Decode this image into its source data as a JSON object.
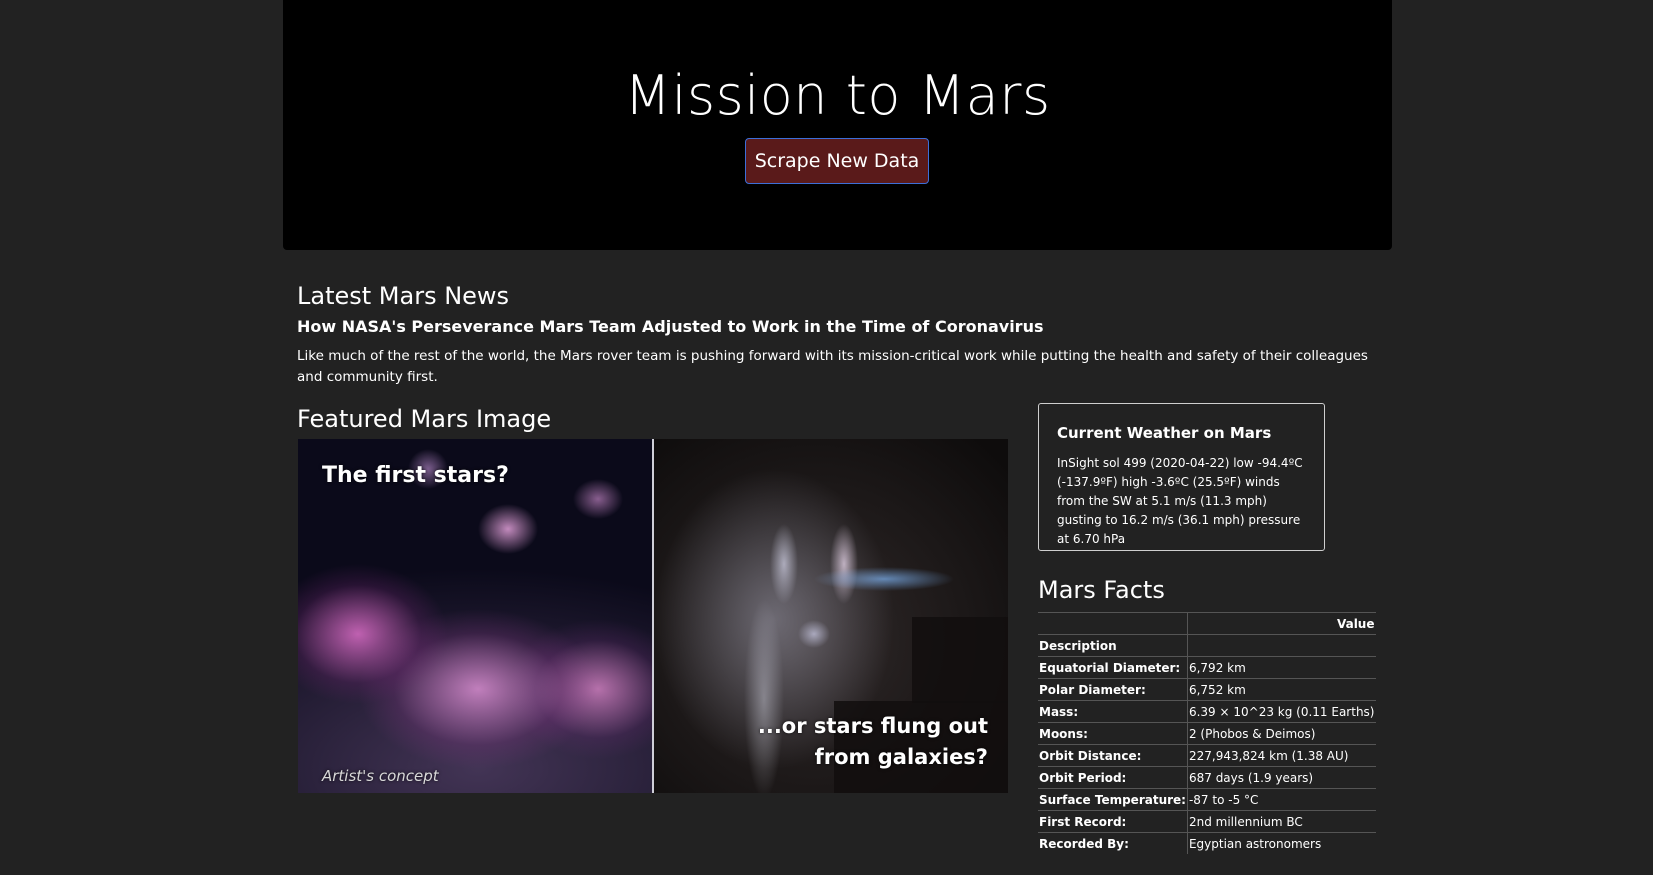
{
  "header": {
    "title": "Mission to Mars",
    "scrape_button_label": "Scrape New Data"
  },
  "news": {
    "section_title": "Latest Mars News",
    "headline": "How NASA's Perseverance Mars Team Adjusted to Work in the Time of Coronavirus",
    "paragraph": "Like much of the rest of the world, the Mars rover team is pushing forward with its mission-critical work while putting the health and safety of their colleagues and community first."
  },
  "featured_image": {
    "section_title": "Featured Mars Image",
    "caption_left": "The first stars?",
    "caption_right_line1": "...or stars flung out",
    "caption_right_line2": "from galaxies?",
    "caption_artist": "Artist's concept"
  },
  "weather": {
    "title": "Current Weather on Mars",
    "text": "InSight sol 499 (2020-04-22) low -94.4ºC (-137.9ºF) high -3.6ºC (25.5ºF) winds from the SW at 5.1 m/s (11.3 mph) gusting to 16.2 m/s (36.1 mph) pressure at 6.70 hPa"
  },
  "facts": {
    "section_title": "Mars Facts",
    "value_header": "Value",
    "description_header": "Description",
    "rows": [
      {
        "label": "Equatorial Diameter:",
        "value": "6,792 km"
      },
      {
        "label": "Polar Diameter:",
        "value": "6,752 km"
      },
      {
        "label": "Mass:",
        "value": "6.39 × 10^23 kg (0.11 Earths)"
      },
      {
        "label": "Moons:",
        "value": "2 (Phobos & Deimos)"
      },
      {
        "label": "Orbit Distance:",
        "value": "227,943,824 km (1.38 AU)"
      },
      {
        "label": "Orbit Period:",
        "value": "687 days (1.9 years)"
      },
      {
        "label": "Surface Temperature:",
        "value": "-87 to -5 °C"
      },
      {
        "label": "First Record:",
        "value": "2nd millennium BC"
      },
      {
        "label": "Recorded By:",
        "value": "Egyptian astronomers"
      }
    ]
  }
}
